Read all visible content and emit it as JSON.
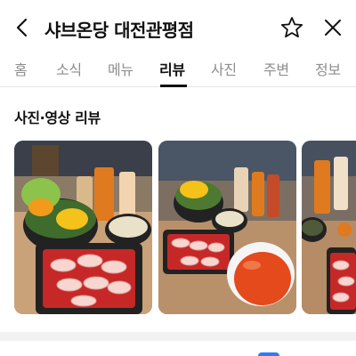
{
  "header": {
    "title": "샤브온당 대전관평점",
    "back_icon": "chevron-left-icon",
    "favorite_icon": "star-outline-icon",
    "close_icon": "close-x-icon"
  },
  "tabs": [
    {
      "label": "홈",
      "active": false
    },
    {
      "label": "소식",
      "active": false
    },
    {
      "label": "메뉴",
      "active": false
    },
    {
      "label": "리뷰",
      "active": true
    },
    {
      "label": "사진",
      "active": false
    },
    {
      "label": "주변",
      "active": false
    },
    {
      "label": "정보",
      "active": false
    }
  ],
  "reviews": {
    "section_title": "사진·영상 리뷰"
  },
  "colors": {
    "text": "#111111",
    "inactive_tab": "#8e8e8e",
    "accent_blue": "#2b7cf7",
    "divider": "#f2f2f2"
  }
}
